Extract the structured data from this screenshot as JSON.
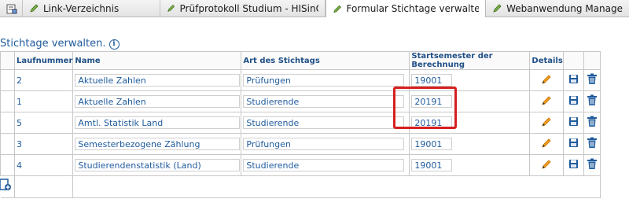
{
  "tabs": [
    {
      "label": "Link-Verzeichnis",
      "active": false
    },
    {
      "label": "Prüfprotokoll Studium - HISinOn...",
      "active": false
    },
    {
      "label": "Formular Stichtage verwalten",
      "active": true
    },
    {
      "label": "Webanwendung Manage",
      "active": false
    }
  ],
  "page": {
    "title": "Stichtage verwalten.",
    "info_icon": "info-icon"
  },
  "table": {
    "headers": [
      "Laufnummer",
      "Name",
      "Art des Stichtags",
      "Startsemester der Berechnung",
      "Details"
    ],
    "rows": [
      {
        "nr": "2",
        "name": "Aktuelle Zahlen",
        "kind": "Prüfungen",
        "semester": "19001"
      },
      {
        "nr": "1",
        "name": "Aktuelle Zahlen",
        "kind": "Studierende",
        "semester": "20191"
      },
      {
        "nr": "5",
        "name": "Amtl. Statistik Land",
        "kind": "Studierende",
        "semester": "20191"
      },
      {
        "nr": "3",
        "name": "Semesterbezogene Zählung",
        "kind": "Prüfungen",
        "semester": "19001"
      },
      {
        "nr": "4",
        "name": "Studierendenstatistik (Land)",
        "kind": "Studierende",
        "semester": "19001"
      }
    ]
  },
  "colors": {
    "link": "#1f5b9c",
    "highlight": "#d61f1f",
    "edit": "#f08a00",
    "save": "#1f5b9c"
  }
}
